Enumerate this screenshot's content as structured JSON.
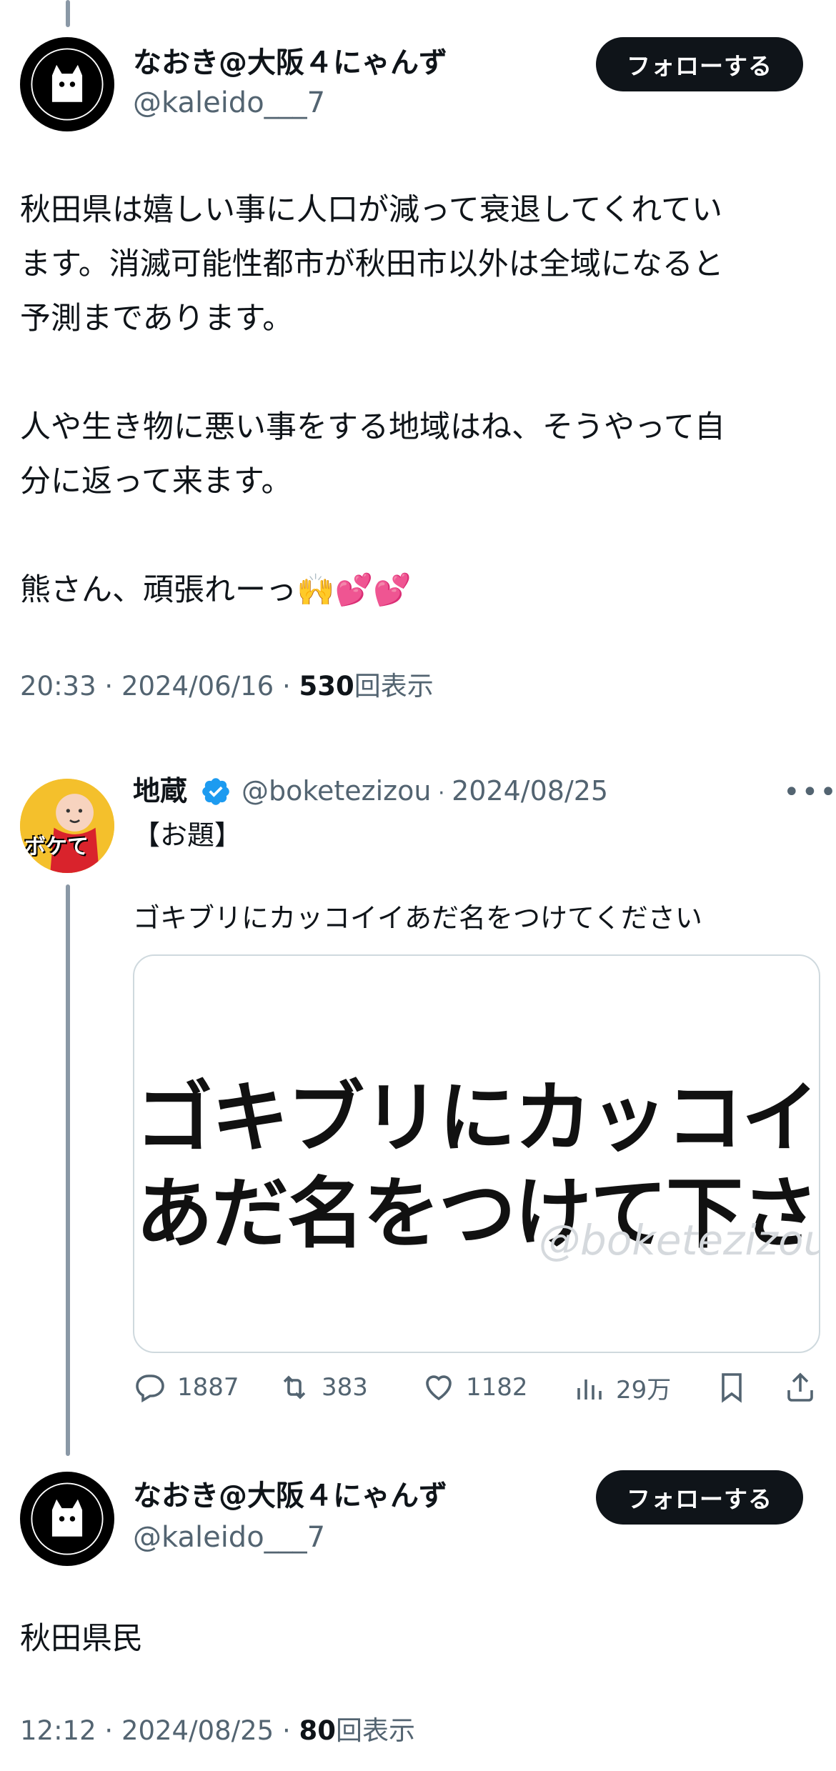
{
  "post1": {
    "display_name": "なおき@大阪４にゃんず",
    "handle": "@kaleido___7",
    "follow_label": "フォローする",
    "text_lines": [
      "秋田県は嬉しい事に人口が減って衰退してくれてい",
      "ます。消滅可能性都市が秋田市以外は全域になると",
      "予測まであります。",
      "",
      "人や生き物に悪い事をする地域はね、そうやって自",
      "分に返って来ます。",
      "",
      "熊さん、頑張れーっ🙌💕💕"
    ],
    "time": "20:33",
    "date": "2024/06/16",
    "views": "530",
    "views_label": "回表示"
  },
  "quote": {
    "avatar_text": "ボケて",
    "display_name": "地蔵",
    "handle": "@boketezizou",
    "date": "2024/08/25",
    "more_label": "•••",
    "title": "【お題】",
    "body": "ゴキブリにカッコイイあだ名をつけてください",
    "media_line1": "ゴキブリにカッコイイ",
    "media_line2": "あだ名をつけて下さい",
    "media_watermark": "@boketezizou",
    "replies": "1887",
    "reposts": "383",
    "likes": "1182",
    "views": "29万"
  },
  "post2": {
    "display_name": "なおき@大阪４にゃんず",
    "handle": "@kaleido___7",
    "follow_label": "フォローする",
    "text": "秋田県民",
    "time": "12:12",
    "date": "2024/08/25",
    "views": "80",
    "views_label": "回表示"
  },
  "colors": {
    "text": "#0f1419",
    "secondary": "#536471",
    "thread_line": "#8a98a6",
    "verified": "#1d9bf0",
    "border": "#cfd9de"
  }
}
